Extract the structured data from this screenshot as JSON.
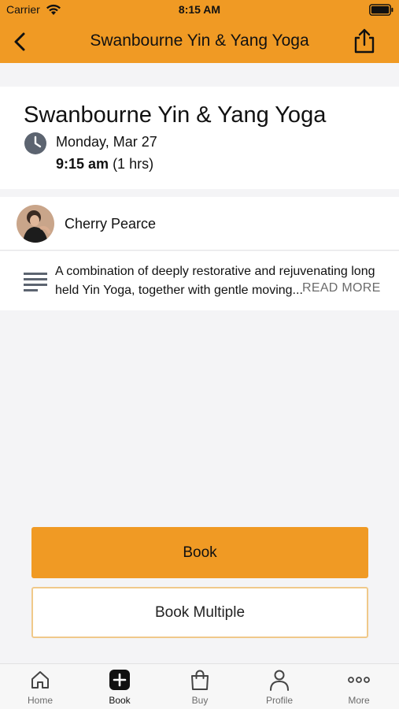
{
  "status_bar": {
    "carrier": "Carrier",
    "time": "8:15 AM",
    "icons": [
      "wifi-icon",
      "battery-icon"
    ]
  },
  "nav": {
    "title": "Swanbourne Yin & Yang Yoga",
    "back_icon": "chevron-left-icon",
    "share_icon": "share-icon"
  },
  "class_info": {
    "title": "Swanbourne Yin & Yang Yoga",
    "date": "Monday, Mar 27",
    "start_time": "9:15 am",
    "duration": "(1 hrs)",
    "icon": "clock-icon"
  },
  "teacher": {
    "name": "Cherry Pearce"
  },
  "description": {
    "text": "A combination of deeply restorative and rejuvenating long held Yin Yoga, together with gentle moving...",
    "read_more": "READ MORE",
    "icon": "text-lines-icon"
  },
  "actions": {
    "book": "Book",
    "book_multiple": "Book Multiple"
  },
  "tabs": [
    {
      "label": "Home",
      "icon": "home-icon",
      "active": false
    },
    {
      "label": "Book",
      "icon": "plus-square-icon",
      "active": true
    },
    {
      "label": "Buy",
      "icon": "shopping-bag-icon",
      "active": false
    },
    {
      "label": "Profile",
      "icon": "person-icon",
      "active": false
    },
    {
      "label": "More",
      "icon": "more-dots-icon",
      "active": false
    }
  ],
  "colors": {
    "accent": "#f09a24",
    "button_border": "#f0c98a",
    "background": "#f4f4f6"
  }
}
